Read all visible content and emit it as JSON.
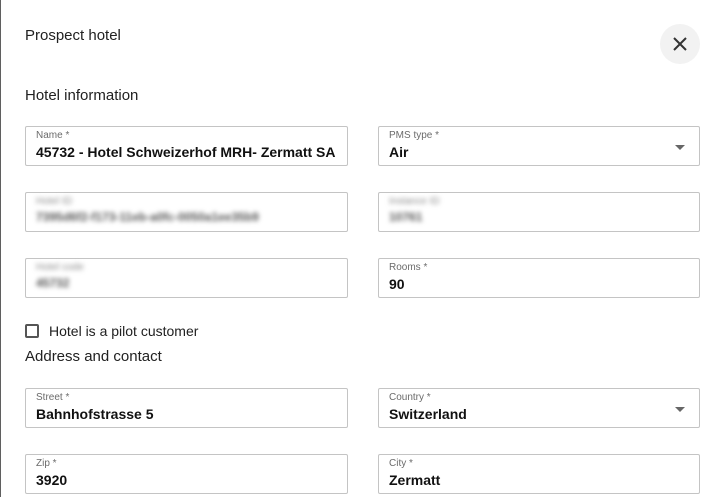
{
  "dialog": {
    "title": "Prospect hotel",
    "close_icon": "close-icon"
  },
  "hotel_info": {
    "section_title": "Hotel information",
    "name": {
      "label": "Name *",
      "value": "45732 - Hotel Schweizerhof MRH- Zermatt SA"
    },
    "pms_type": {
      "label": "PMS type *",
      "value": "Air"
    },
    "blurred_1": {
      "label": "Hotel ID",
      "value": "7395d6f2-f173-11eb-a0fc-0050a1ee35b9"
    },
    "blurred_2": {
      "label": "Instance ID",
      "value": "10761"
    },
    "blurred_3": {
      "label": "Hotel code",
      "value": "45732"
    },
    "rooms": {
      "label": "Rooms *",
      "value": "90"
    },
    "pilot_checkbox_label": "Hotel is a pilot customer",
    "pilot_checked": false
  },
  "address": {
    "section_title": "Address and contact",
    "street": {
      "label": "Street *",
      "value": "Bahnhofstrasse 5"
    },
    "country": {
      "label": "Country *",
      "value": "Switzerland"
    },
    "zip": {
      "label": "Zip *",
      "value": "3920"
    },
    "city": {
      "label": "City *",
      "value": "Zermatt"
    }
  }
}
